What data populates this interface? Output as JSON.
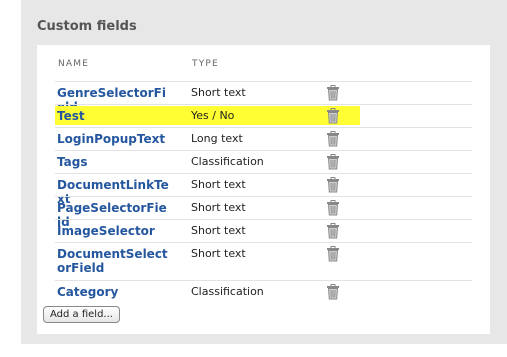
{
  "section": {
    "title": "Custom fields"
  },
  "table": {
    "columns": {
      "name": "NAME",
      "type": "TYPE"
    },
    "rows": [
      {
        "name": "GenreSelectorField",
        "type": "Short text",
        "highlighted": false
      },
      {
        "name": "Test",
        "type": "Yes / No",
        "highlighted": true
      },
      {
        "name": "LoginPopupText",
        "type": "Long text",
        "highlighted": false
      },
      {
        "name": "Tags",
        "type": "Classification",
        "highlighted": false
      },
      {
        "name": "DocumentLinkText",
        "type": "Short text",
        "highlighted": false
      },
      {
        "name": "PageSelectorField",
        "type": "Short text",
        "highlighted": false
      },
      {
        "name": "ImageSelector",
        "type": "Short text",
        "highlighted": false
      },
      {
        "name": "DocumentSelectorField",
        "type": "Short text",
        "highlighted": false
      },
      {
        "name": "Category",
        "type": "Classification",
        "highlighted": false
      }
    ],
    "row_delete_icon": "trash-icon"
  },
  "actions": {
    "add_field_label": "Add a field..."
  },
  "colors": {
    "highlight": "#ffff33",
    "link": "#25579f",
    "panel": "#e7e7e7"
  }
}
